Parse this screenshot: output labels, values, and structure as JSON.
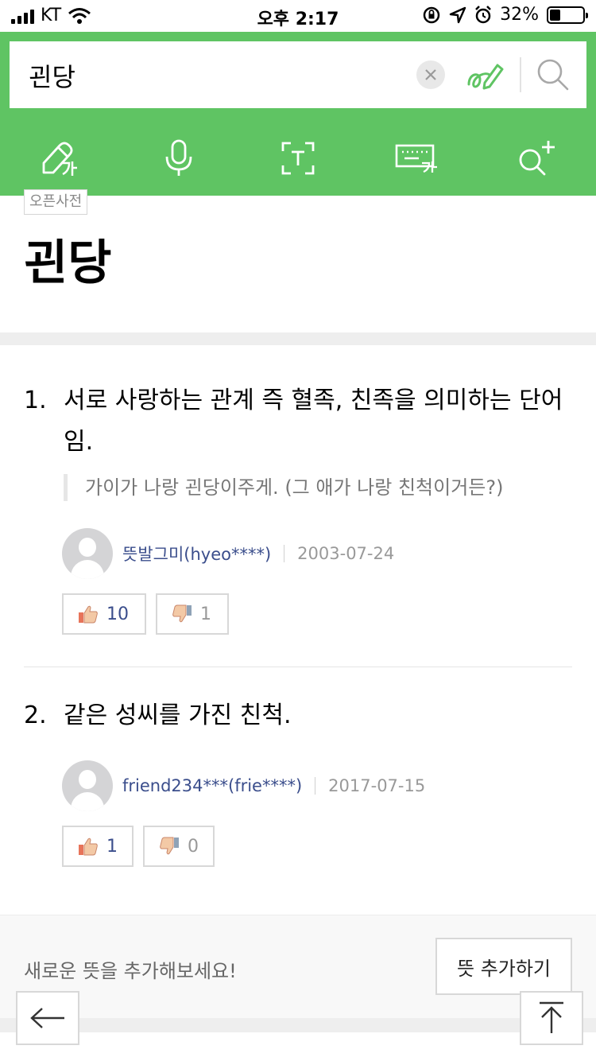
{
  "status_bar": {
    "carrier": "KT",
    "time": "오후 2:17",
    "battery": "32%",
    "battery_level": 0.32
  },
  "search": {
    "query": "괸당"
  },
  "toolbar": {
    "items": [
      {
        "icon": "handwriting-icon"
      },
      {
        "icon": "microphone-icon"
      },
      {
        "icon": "text-scan-icon"
      },
      {
        "icon": "keyboard-icon"
      },
      {
        "icon": "search-add-icon"
      }
    ]
  },
  "entry": {
    "badge": "오픈사전",
    "headword": "괸당"
  },
  "definitions": [
    {
      "num": "1.",
      "text": "서로 사랑하는 관계 즉 혈족, 친족을 의미하는 단어임.",
      "example": "가이가 나랑 괸당이주게. (그 애가 나랑 친척이거든?)",
      "author": "뜻발그미(hyeo****)",
      "date": "2003-07-24",
      "likes": "10",
      "dislikes": "1"
    },
    {
      "num": "2.",
      "text": "같은 성씨를 가진 친척.",
      "author": "friend234***(frie****)",
      "date": "2017-07-15",
      "likes": "1",
      "dislikes": "0"
    }
  ],
  "add": {
    "prompt": "새로운 뜻을 추가해보세요!",
    "button": "뜻 추가하기"
  },
  "colors": {
    "brand_green": "#5fc463",
    "author_link": "#3b4e8c"
  }
}
